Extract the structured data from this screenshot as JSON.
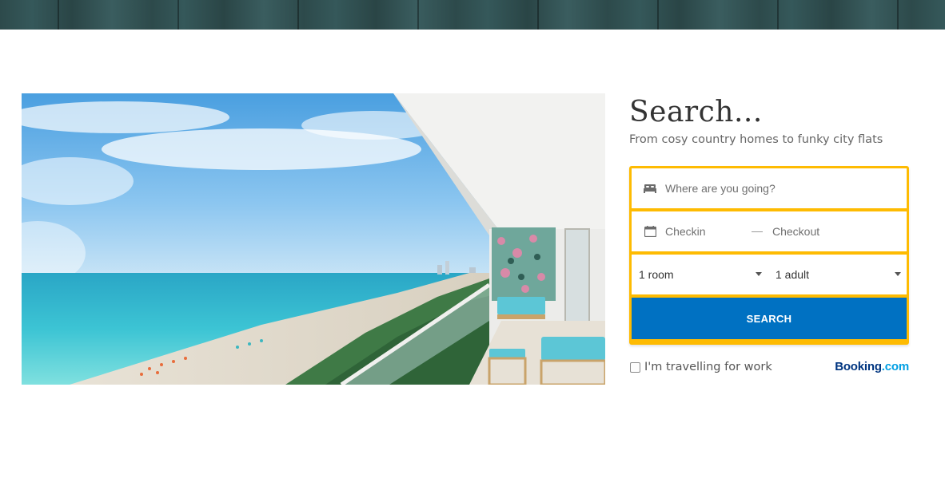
{
  "hero": {
    "image_description": "balcony-sea-view"
  },
  "search": {
    "title": "Search...",
    "subtitle": "From cosy country homes to funky city flats",
    "destination_placeholder": "Where are you going?",
    "checkin_placeholder": "Checkin",
    "checkout_placeholder": "Checkout",
    "rooms_value": "1 room",
    "adults_value": "1 adult",
    "button_label": "SEARCH",
    "work_label": "I'm travelling for work",
    "work_checked": false,
    "brand_name": "Booking",
    "brand_tld": ".com"
  },
  "colors": {
    "accent_yellow": "#febb02",
    "button_blue": "#0071c2",
    "brand_navy": "#003580",
    "brand_light_blue": "#009fe3",
    "banner_teal": "#2d4a4b"
  },
  "icons": [
    "bed-icon",
    "calendar-icon",
    "caret-down-icon"
  ]
}
